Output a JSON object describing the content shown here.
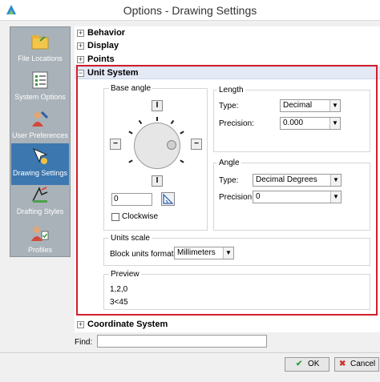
{
  "window": {
    "title": "Options - Drawing Settings"
  },
  "sidebar": {
    "items": [
      {
        "label": "File Locations",
        "icon": "folder-icon"
      },
      {
        "label": "System Options",
        "icon": "checklist-icon"
      },
      {
        "label": "User Preferences",
        "icon": "user-preferences-icon"
      },
      {
        "label": "Drawing Settings",
        "icon": "drawing-settings-icon",
        "active": true
      },
      {
        "label": "Drafting Styles",
        "icon": "drafting-styles-icon"
      },
      {
        "label": "Profiles",
        "icon": "profiles-icon"
      }
    ]
  },
  "sections": {
    "behavior": "Behavior",
    "display": "Display",
    "points": "Points",
    "unit_system": "Unit System",
    "coordinate_system": "Coordinate System"
  },
  "expand_symbol": "+",
  "collapse_symbol": "−",
  "base_angle": {
    "title": "Base angle",
    "value": "0",
    "clockwise_label": "Clockwise",
    "clockwise_checked": false
  },
  "length": {
    "title": "Length",
    "type_label": "Type:",
    "type_value": "Decimal",
    "precision_label": "Precision:",
    "precision_value": "0.000"
  },
  "angle": {
    "title": "Angle",
    "type_label": "Type:",
    "type_value": "Decimal Degrees",
    "precision_label": "Precision:",
    "precision_value": "0"
  },
  "units_scale": {
    "title": "Units scale",
    "block_units_label": "Block units format:",
    "block_units_value": "Millimeters"
  },
  "preview": {
    "title": "Preview",
    "line1": "1,2,0",
    "line2": "3<45"
  },
  "find": {
    "label": "Find:",
    "value": ""
  },
  "buttons": {
    "ok": "OK",
    "cancel": "Cancel"
  },
  "colors": {
    "accent": "#3c77b0",
    "highlight_border": "#d21e2b",
    "ok_check": "#2f9e3a",
    "cancel_x": "#d0332f"
  }
}
